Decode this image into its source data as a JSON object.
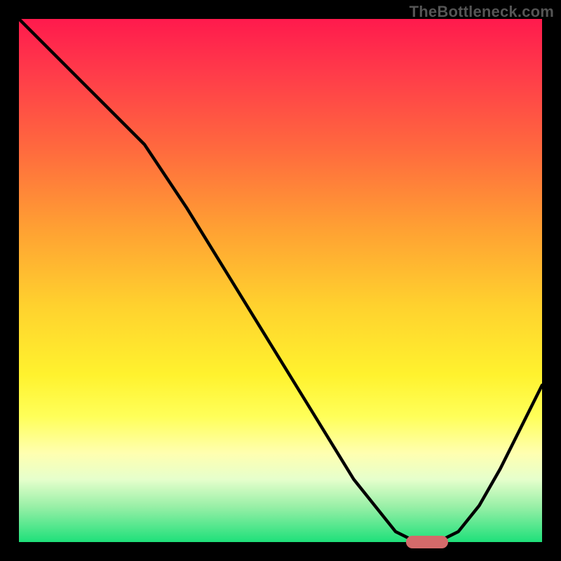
{
  "watermark": "TheBottleneck.com",
  "colors": {
    "frame": "#000000",
    "curve": "#000000",
    "marker": "#d36a6a",
    "gradient_top": "#ff1a4d",
    "gradient_bottom": "#1ee07a"
  },
  "chart_data": {
    "type": "line",
    "title": "",
    "xlabel": "",
    "ylabel": "",
    "xlim": [
      0,
      100
    ],
    "ylim": [
      0,
      100
    ],
    "grid": false,
    "legend": false,
    "series": [
      {
        "name": "bottleneck-curve",
        "x": [
          0,
          8,
          16,
          24,
          32,
          40,
          48,
          56,
          64,
          72,
          76,
          80,
          84,
          88,
          92,
          96,
          100
        ],
        "y": [
          100,
          92,
          84,
          76,
          64,
          51,
          38,
          25,
          12,
          2,
          0,
          0,
          2,
          7,
          14,
          22,
          30
        ]
      }
    ],
    "marker": {
      "x_range": [
        74,
        82
      ],
      "y": 0,
      "label": ""
    },
    "notes": "y-axis qualitatively represents bottleneck severity (100 = worst/red, 0 = best/green). x-axis is an unlabeled normalized scale. Values are visually estimated from the rendered curve against the gradient background; the image carries no numeric tick labels."
  }
}
